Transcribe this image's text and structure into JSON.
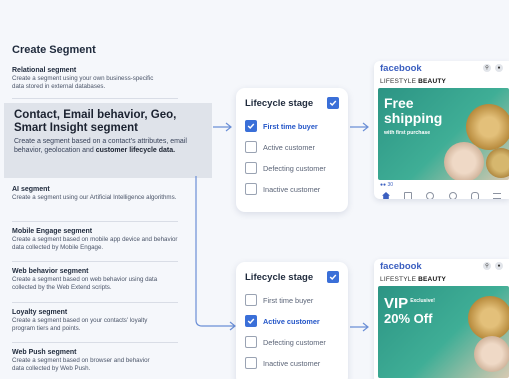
{
  "page_title": "Create Segment",
  "segments": [
    {
      "title": "Relational segment",
      "desc": "Create a segment using your own business-specific data stored in external databases."
    },
    {
      "title": "AI segment",
      "desc": "Create a segment using our Artificial Intelligence algorithms."
    },
    {
      "title": "Mobile Engage segment",
      "desc": "Create a segment based on mobile app device and behavior data collected by Mobile Engage."
    },
    {
      "title": "Web behavior segment",
      "desc": "Create a segment based on web behavior using data collected by the Web Extend scripts."
    },
    {
      "title": "Loyalty segment",
      "desc": "Create a segment based on your contacts' loyalty program tiers and points."
    },
    {
      "title": "Web Push segment",
      "desc": "Create a segment based on browser and behavior data collected by Web Push."
    }
  ],
  "highlight": {
    "title": "Contact, Email behavior, Geo, Smart Insight segment",
    "desc_prefix": "Create a segment based on a contact's attributes, email behavior, geolocation and ",
    "desc_bold": "customer lifecycle data."
  },
  "cards": [
    {
      "title": "Lifecycle stage",
      "options": [
        {
          "label": "First time buyer",
          "checked": true
        },
        {
          "label": "Active customer",
          "checked": false
        },
        {
          "label": "Defecting customer",
          "checked": false
        },
        {
          "label": "Inactive customer",
          "checked": false
        }
      ]
    },
    {
      "title": "Lifecycle stage",
      "options": [
        {
          "label": "First time buyer",
          "checked": false
        },
        {
          "label": "Active customer",
          "checked": true
        },
        {
          "label": "Defecting customer",
          "checked": false
        },
        {
          "label": "Inactive customer",
          "checked": false
        }
      ]
    }
  ],
  "ads": [
    {
      "fb_logo": "facebook",
      "brand_prefix": "LIFESTYLE ",
      "brand_bold": "BEAUTY",
      "headline_1": "Free",
      "headline_2": "shipping",
      "subline": "with first purchase",
      "reaction_count": "30"
    },
    {
      "fb_logo": "facebook",
      "brand_prefix": "LIFESTYLE ",
      "brand_bold": "BEAUTY",
      "headline_1": "VIP",
      "headline_tag": "Exclusive!",
      "headline_2": "20% Off"
    }
  ],
  "colors": {
    "accent": "#3a6fd8",
    "selected_text": "#2456c8",
    "facebook": "#3b5fc0",
    "highlight_bg": "#dfe3ea",
    "ad_bg": "#2c9484"
  }
}
